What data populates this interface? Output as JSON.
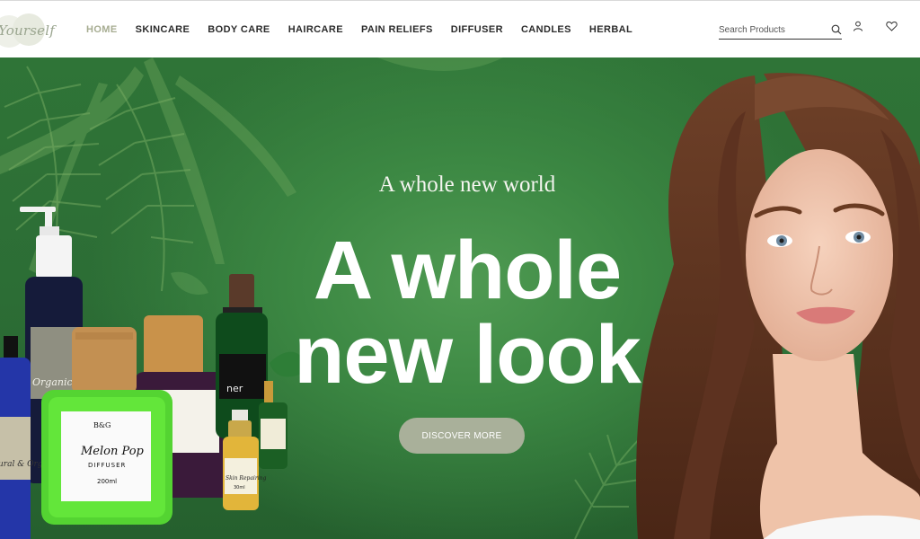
{
  "header": {
    "logo_text": "Yourself",
    "nav": [
      {
        "label": "HOME",
        "active": true
      },
      {
        "label": "SKINCARE",
        "active": false
      },
      {
        "label": "BODY CARE",
        "active": false
      },
      {
        "label": "HAIRCARE",
        "active": false
      },
      {
        "label": "PAIN RELIEFS",
        "active": false
      },
      {
        "label": "DIFFUSER",
        "active": false
      },
      {
        "label": "CANDLES",
        "active": false
      },
      {
        "label": "HERBAL",
        "active": false
      }
    ],
    "search": {
      "placeholder": "Search Products",
      "value": ""
    },
    "icons": [
      "search-icon",
      "user-icon",
      "heart-icon"
    ]
  },
  "hero": {
    "subtitle": "A whole new world",
    "title_line1": "A whole",
    "title_line2": "new look",
    "cta_label": "DISCOVER MORE"
  },
  "products": {
    "diffuser_label": "Melon Pop",
    "diffuser_sub": "DIFFUSER",
    "diffuser_size": "200ml",
    "brand_mark": "B&G",
    "serum_label": "Skin Repairing",
    "serum_size": "30ml",
    "pump_label": "Organic S",
    "blue_label": "ural & Organ"
  },
  "colors": {
    "accent": "#a7ad92",
    "hero_green": "#3c8843",
    "cta_bg": "#a9b09a",
    "nav_text": "#2c2c2c"
  }
}
